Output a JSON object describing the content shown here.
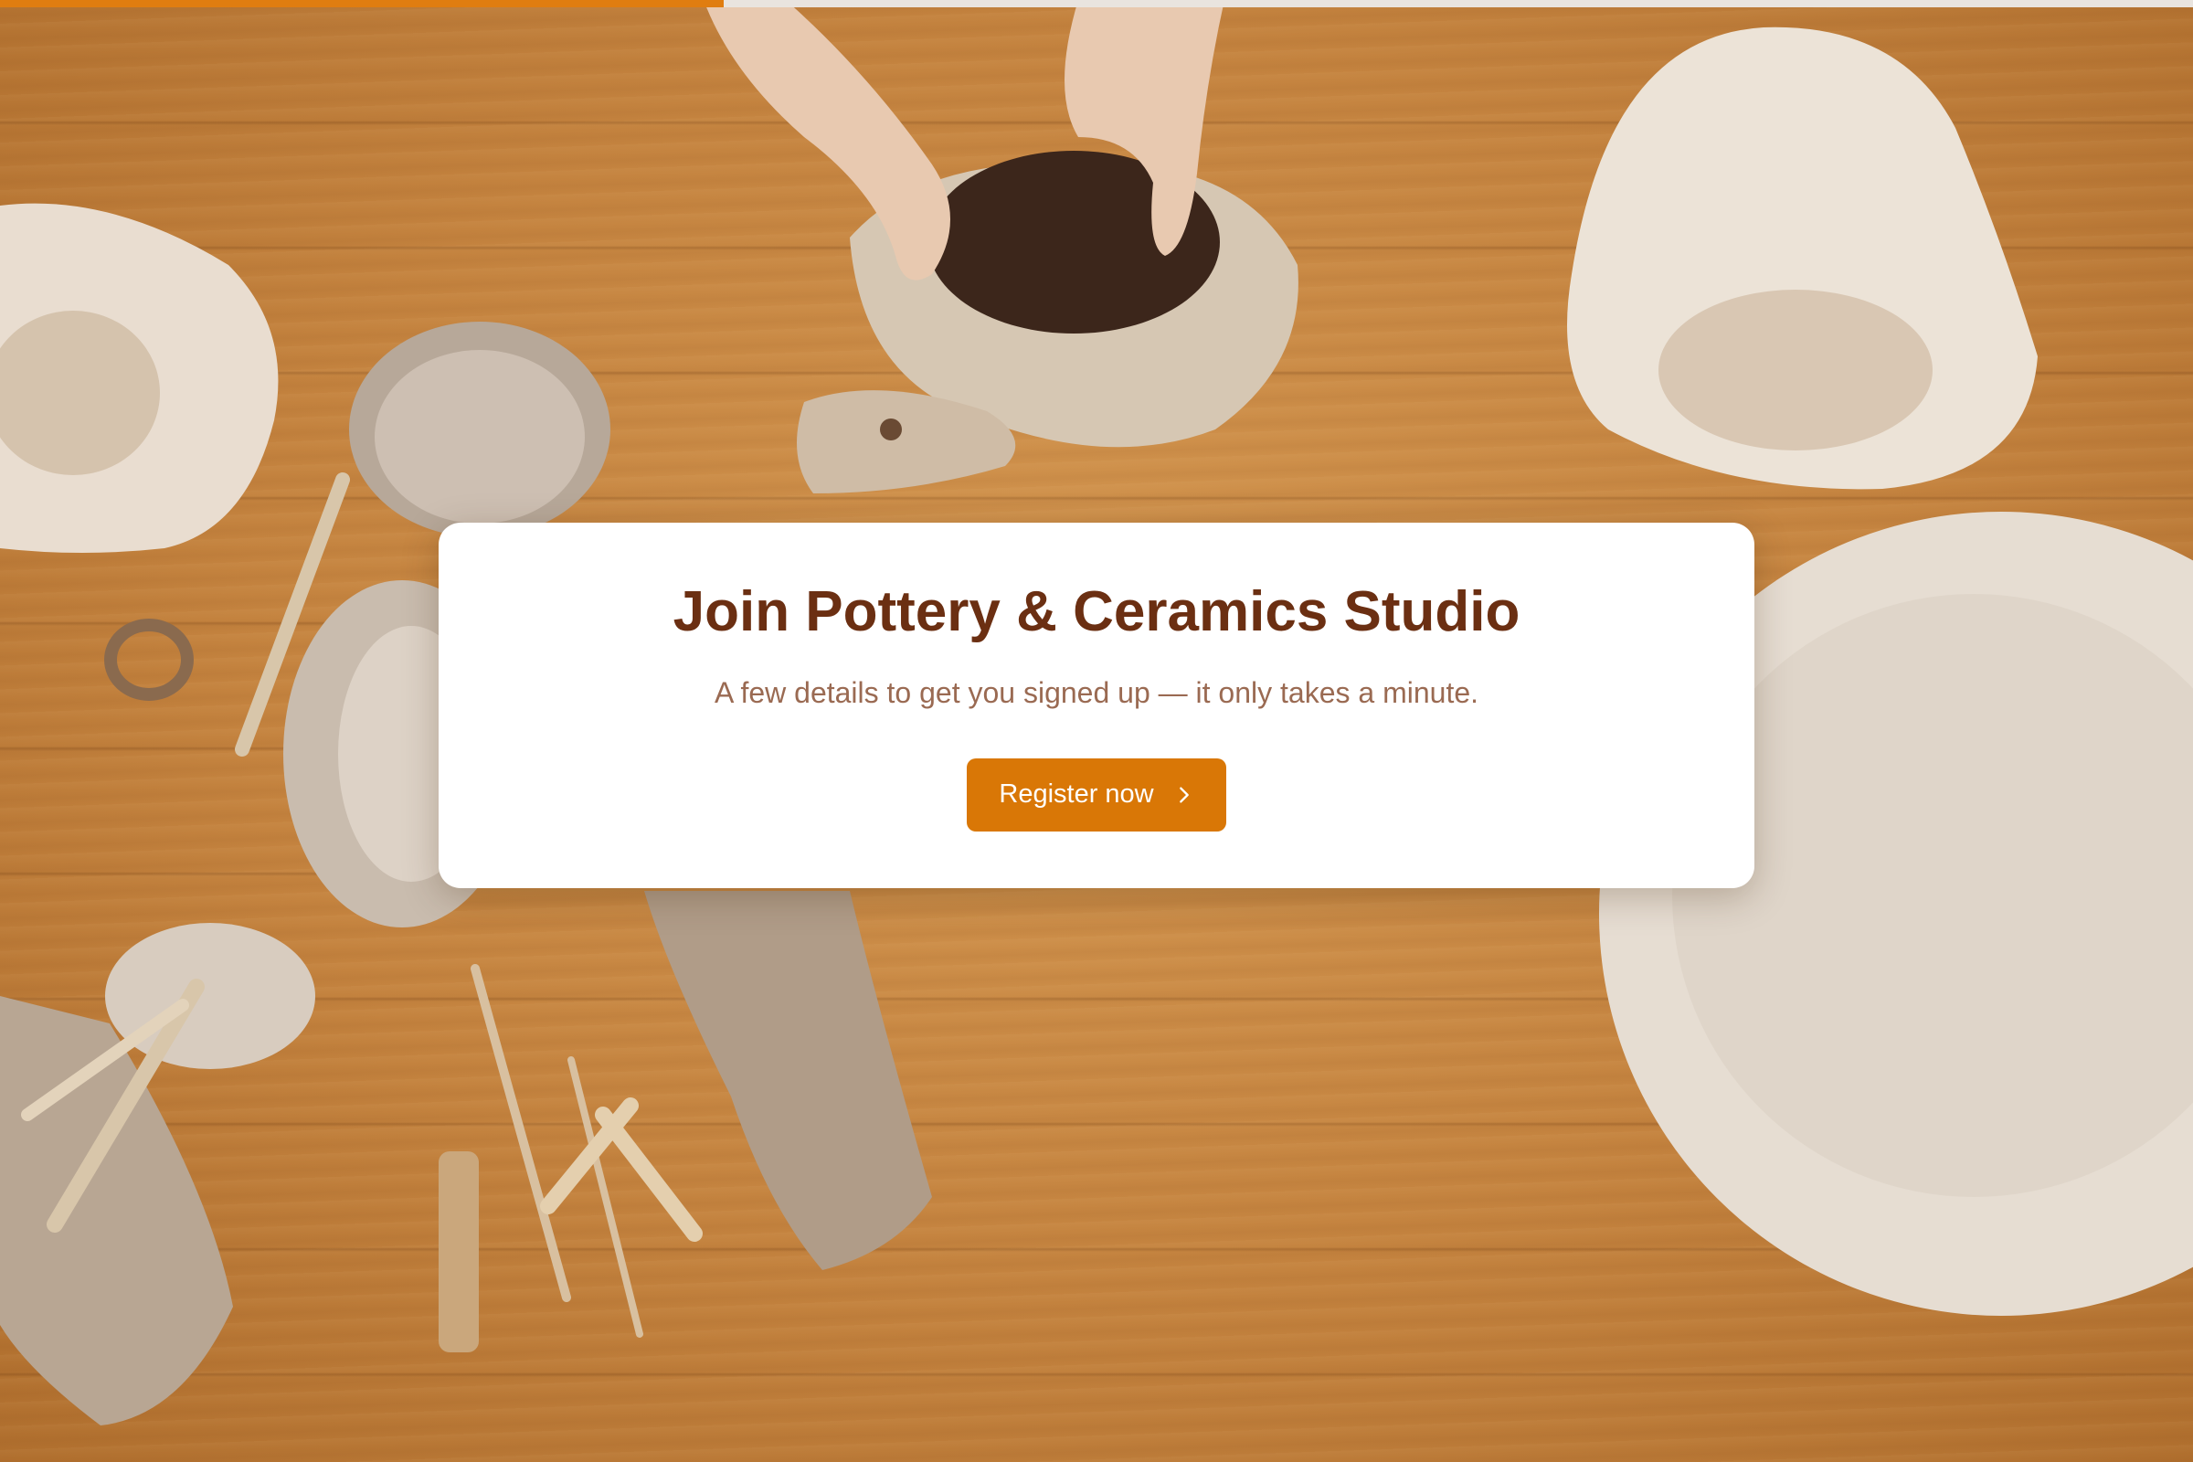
{
  "progress": {
    "value_percent": 33,
    "fill_color": "#e07d10",
    "track_color": "#e9e4df"
  },
  "background": {
    "image": "pottery-workbench-photo"
  },
  "card": {
    "title": "Join Pottery & Ceramics Studio",
    "subtitle": "A few details to get you signed up — it only takes a minute.",
    "button_label": "Register now",
    "button_icon": "chevron-right-icon",
    "title_color": "#6b2f12",
    "button_color": "#d97706"
  }
}
